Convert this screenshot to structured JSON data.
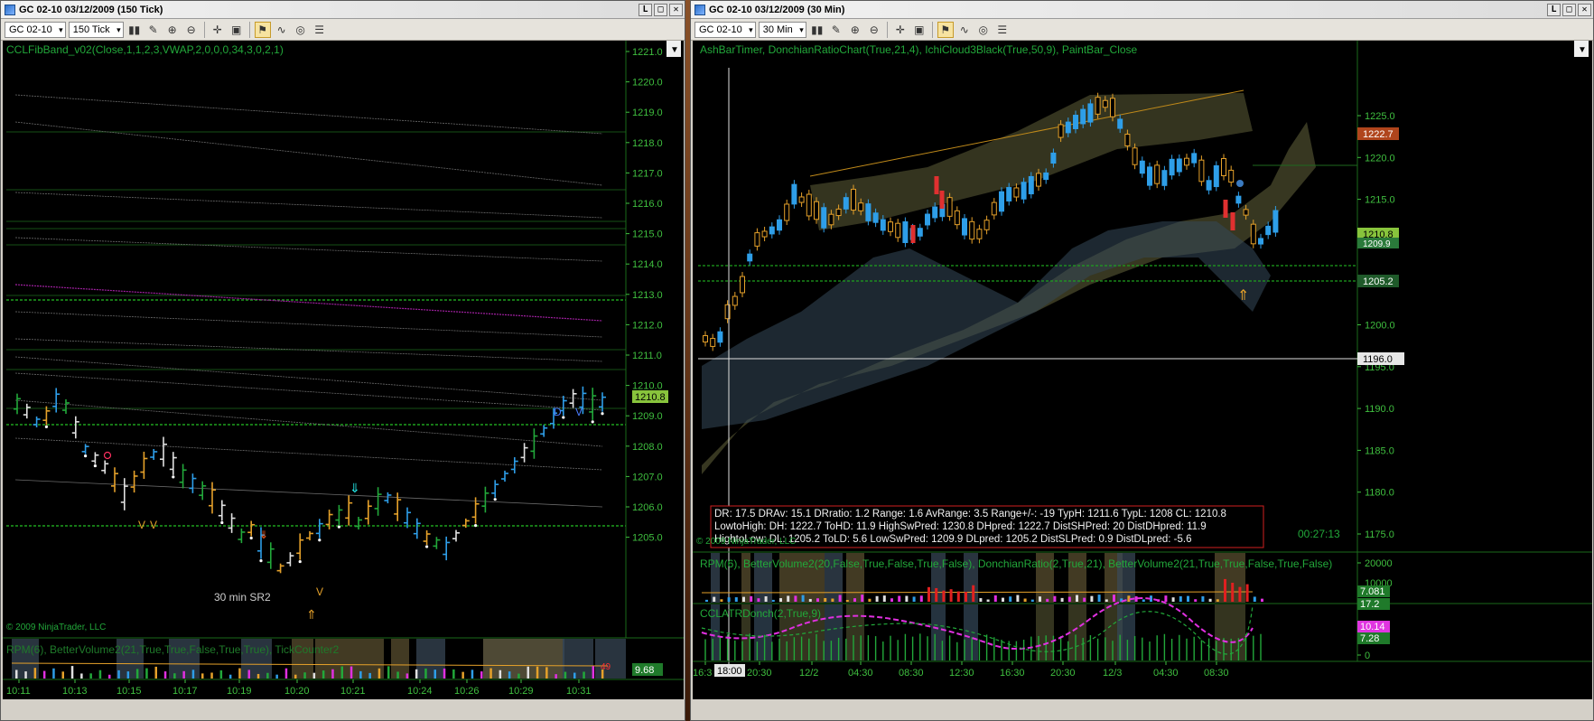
{
  "left_window": {
    "title": "GC 02-10  03/12/2009 (150 Tick)",
    "window_buttons": [
      "L",
      "□",
      "✕"
    ],
    "toolbar": {
      "instrument": "GC 02-10",
      "interval": "150 Tick"
    },
    "indicator_label": "CCLFibBand_v02(Close,1,1,2,3,VWAP,2,0,0,0,34,3,0,2,1)",
    "price_axis": [
      "1221.0",
      "1220.0",
      "1219.0",
      "1218.0",
      "1217.0",
      "1216.0",
      "1215.0",
      "1214.0",
      "1213.0",
      "1212.0",
      "1211.0",
      "1210.0",
      "1209.0",
      "1208.0",
      "1207.0",
      "1206.0",
      "1205.0"
    ],
    "last_price": "1210.8",
    "sr_label": "30 min SR2",
    "copyright": "© 2009 NinjaTrader, LLC",
    "markers": [
      "D",
      "V",
      "V",
      "V",
      "V"
    ],
    "lower_label": "RPM(6),  BetterVolume2(21,True,True,False,True,True),  TickCounter2",
    "lower_value": "9.68",
    "tick_count": "49",
    "time_axis": [
      "10:11",
      "10:13",
      "10:15",
      "10:17",
      "10:19",
      "10:20",
      "10:21",
      "10:24",
      "10:26",
      "10:29",
      "10:31"
    ]
  },
  "right_window": {
    "title": "GC 02-10  03/12/2009 (30 Min)",
    "window_buttons": [
      "L",
      "□",
      "✕"
    ],
    "toolbar": {
      "instrument": "GC 02-10",
      "interval": "30 Min"
    },
    "indicator_label": "AshBarTimer,  DonchianRatioChart(True,21,4),  IchiCloud3Black(True,50,9),  PaintBar_Close",
    "price_axis": [
      "1225.0",
      "1220.0",
      "1215.0",
      "1210.0",
      "1205.0",
      "1200.0",
      "1195.0",
      "1190.0",
      "1185.0",
      "1180.0",
      "1175.0"
    ],
    "price_tags": {
      "high": "1222.7",
      "last": "1210.8",
      "last2": "1209.9",
      "low": "1205.2",
      "cursor": "1196.0"
    },
    "info_box": {
      "line1": "DR: 17.5 DRAv: 15.1 DRratio: 1.2 Range: 1.6 AvRange: 3.5 Range+/-: -19 TypH: 1211.6 TypL: 1208 CL: 1210.8",
      "line2": "LowtoHigh:     DH: 1222.7 ToHD: 11.9 HighSwPred: 1230.8 DHpred: 1222.7 DistSHPred: 20  DistDHpred: 11.9",
      "line3": "HightoLow:     DL: 1205.2 ToLD: 5.6 LowSwPred: 1209.9 DLpred: 1205.2 DistSLPred: 0.9  DistDLpred: -5.6"
    },
    "copyright": "© 2009 NinjaTrader, LLC",
    "timer": "00:27:13",
    "panel2_label": "RPM(6),  BetterVolume2(20,False,True,False,True,False),  DonchianRatio(2,True,21),  BetterVolume2(21,True,True,False,True,False)",
    "panel2_axis": [
      "20000",
      "10000"
    ],
    "panel2_tags": [
      "7.081",
      "17.2"
    ],
    "panel3_label": "CCLATRDonch(2,True,9)",
    "panel3_axis": [
      "20",
      "10",
      "0"
    ],
    "panel3_tags": [
      "10.14",
      "7.28"
    ],
    "time_axis": [
      "16:3",
      "18:00",
      "20:30",
      "12/2",
      "04:30",
      "08:30",
      "12:30",
      "16:30",
      "20:30",
      "12/3",
      "04:30",
      "08:30"
    ],
    "cursor_time": "18:00"
  },
  "colors": {
    "green_text": "#00b050",
    "axis_text": "#3fbf3f",
    "price_tag": "#88c43c",
    "up": "#e5a12a",
    "down": "#2e9ee8"
  }
}
